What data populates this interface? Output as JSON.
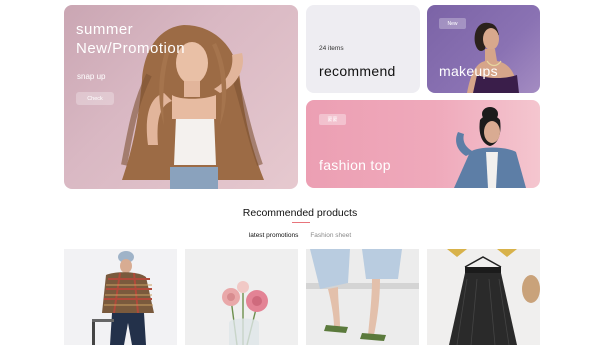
{
  "hero": {
    "title_line1": "summer",
    "title_line2": "New/Promotion",
    "subtitle": "snap up",
    "button_label": "Check"
  },
  "recommend": {
    "count": "24 items",
    "label": "recommend"
  },
  "makeups": {
    "tag": "New",
    "label": "makeups"
  },
  "fashion": {
    "tag": "蒙蒙",
    "label": "fashion top"
  },
  "section": {
    "title": "Recommended products",
    "accent_color": "#e8747b"
  },
  "tabs": [
    {
      "label": "latest promotions",
      "active": true
    },
    {
      "label": "Fashion sheet",
      "active": false
    }
  ],
  "products": [
    {
      "image": "model-plaid-jacket-photo"
    },
    {
      "image": "pink-flowers-vase-photo"
    },
    {
      "image": "green-sandals-jeans-photo"
    },
    {
      "image": "black-tulle-skirt-photo"
    }
  ],
  "colors": {
    "hero_bg": "#d4b3bf",
    "recommend_bg": "#eeedf2",
    "makeups_bg": "#8a72b3",
    "fashion_bg": "#efa9bb"
  }
}
